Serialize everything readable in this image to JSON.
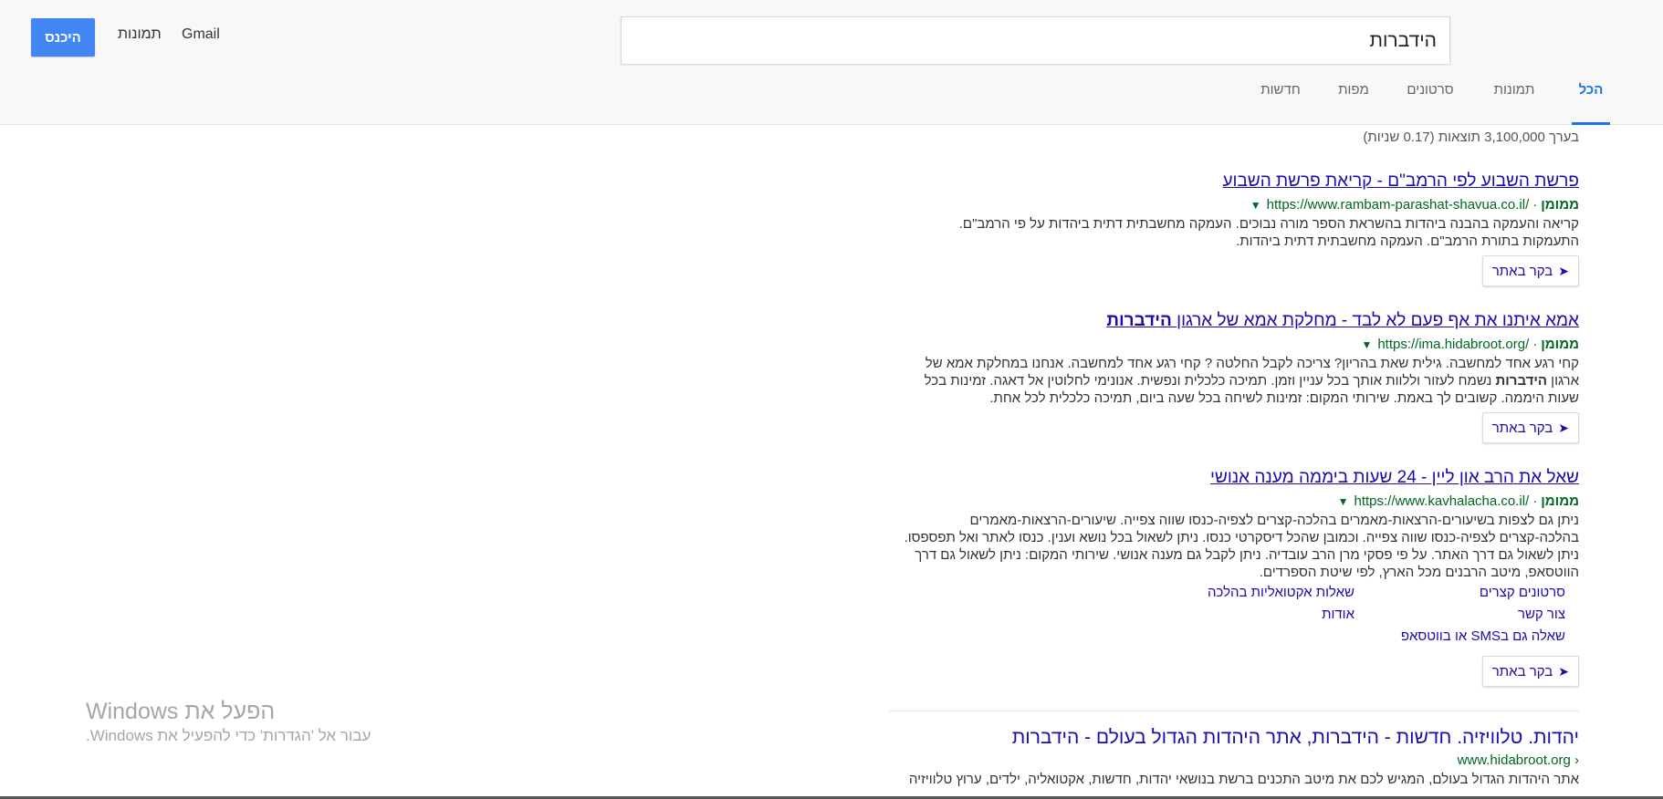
{
  "search": {
    "query": "הידברות"
  },
  "top_links": {
    "sign_in": "היכנס",
    "images": "תמונות",
    "gmail": "Gmail"
  },
  "tabs": [
    "הכל",
    "תמונות",
    "סרטונים",
    "מפות",
    "חדשות"
  ],
  "stats": "בערך 3,100,000 תוצאות (0.17 שניות)",
  "ad_label": "ממומן",
  "visit_label": "בקר באתר",
  "results": [
    {
      "title": "פרשת השבוע לפי הרמב\"ם - קריאת פרשת השבוע",
      "url": "https://www.rambam-parashat-shavua.co.il/",
      "snippet_lines": [
        "קריאה והעמקה בהבנה ביהדות בהשראת הספר מורה נבוכים. העמקה מחשבתית דתית ביהדות על פי הרמב\"ם.",
        "התעמקות בתורת הרמב\"ם. העמקה מחשבתית דתית ביהדות."
      ]
    },
    {
      "title_prefix": "אמא איתנו את אף פעם לא לבד - מחלקת אמא של ארגון ",
      "title_bold": "הידברות",
      "url": "https://ima.hidabroot.org/",
      "snippet_line1": "קחי רגע אחד למחשבה. גילית שאת בהריון? צריכה לקבל החלטה ? קחי רגע אחד למחשבה. אנחנו במחלקת אמא של",
      "snippet_line2_prefix": "ארגון ",
      "snippet_line2_bold": "הידברות",
      "snippet_line2_suffix": " נשמח לעזור וללוות אותך בכל עניין וזמן. תמיכה כלכלית ונפשית. אנונימי לחלוטין אל דאגה. זמינות בכל",
      "snippet_line3": "שעות היממה. קשובים לך באמת. שירותי המקום: זמינות לשיחה בכל שעה ביום, תמיכה כלכלית לכל אחת."
    },
    {
      "title": "שאל את הרב און ליין - 24 שעות ביממה מענה אנושי",
      "url": "https://www.kavhalacha.co.il/",
      "snippet_lines": [
        "ניתן גם לצפות בשיעורים-הרצאות-מאמרים בהלכה-קצרים לצפיה-כנסו שווה צפייה. שיעורים-הרצאות-מאמרים",
        "בהלכה-קצרים לצפיה-כנסו שווה צפייה. וכמובן שהכל דיסקרטי כנסו. ניתן לשאול בכל נושא וענין. כנסו לאתר ואל תפספסו.",
        "ניתן לשאול גם דרך האתר. על פי פסקי מרן הרב עובדיה. ניתן לקבל גם מענה אנושי. שירותי המקום: ניתן לשאול גם דרך",
        "הווטסאפ, מיטב הרבנים מכל הארץ, לפי שיטת הספרדים."
      ],
      "sitelinks": [
        "סרטונים קצרים",
        "שאלות אקטואליות בהלכה",
        "צור קשר",
        "אודות",
        "שאלה גם בSMS או בווטסאפ"
      ]
    }
  ],
  "organic": {
    "title": "יהדות. טלוויזיה. חדשות - הידברות, אתר היהדות הגדול בעולם - הידברות",
    "url": "www.hidabroot.org ›",
    "snippet": "אתר היהדות הגדול בעולם, המגיש לכם את מיטב התכנים ברשת בנושאי יהדות, חדשות, אקטואליה, ילדים, ערוץ טלוויזיה"
  },
  "watermark": {
    "title": "הפעל את Windows",
    "subtitle": "עבור אל 'הגדרות' כדי להפעיל את Windows."
  },
  "colors": {
    "accent": "#1a73e8",
    "link": "#1a0dab",
    "url_green": "#006621",
    "button_blue": "#4285f4"
  }
}
